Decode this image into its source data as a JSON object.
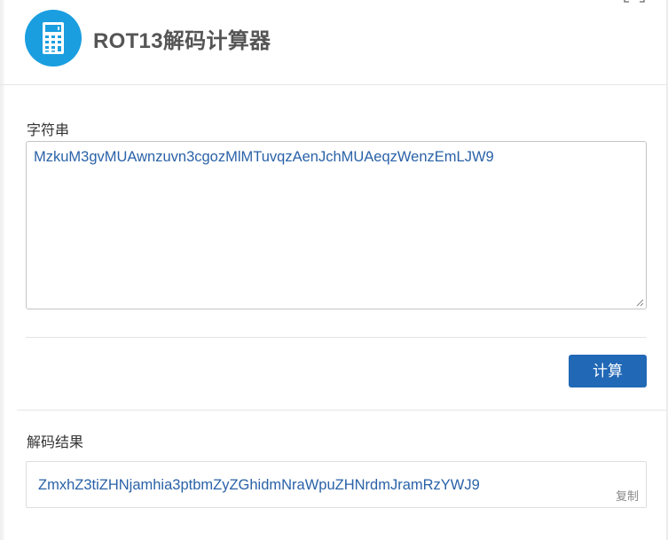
{
  "header": {
    "title": "ROT13解码计算器",
    "icon": "calculator-icon"
  },
  "input": {
    "label": "字符串",
    "value": "MzkuM3gvMUAwnzuvn3cgozMlMTuvqzAenJchMUAeqzWenzEmLJW9"
  },
  "actions": {
    "calculate_label": "计算"
  },
  "result": {
    "label": "解码结果",
    "value": "ZmxhZ3tiZHNjamhia3ptbmZyZGhidmNraWpuZHNrdmJramRzYWJ9",
    "copy_label": "复制"
  },
  "colors": {
    "accent": "#2168b6",
    "icon_bg": "#1a9ee0",
    "value_text": "#2a62a8"
  }
}
